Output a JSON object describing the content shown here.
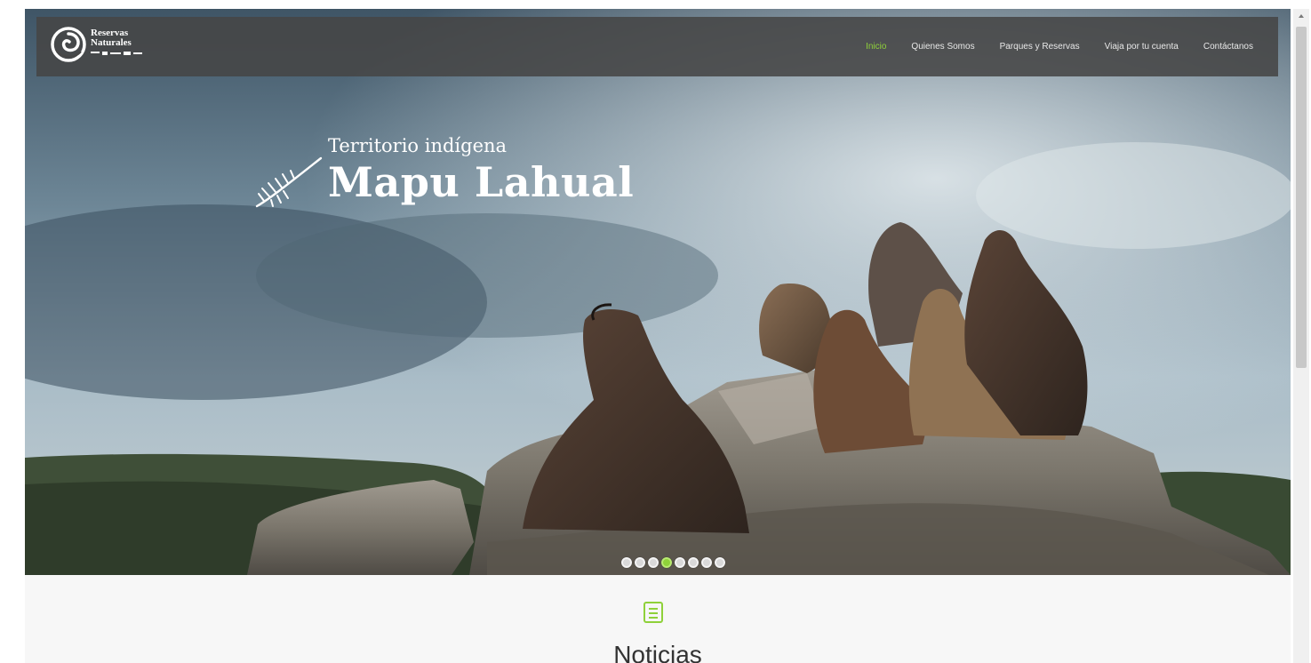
{
  "logo": {
    "line1": "Reservas",
    "line2": "Naturales",
    "icon": "swirl-logo-icon"
  },
  "nav": {
    "items": [
      {
        "label": "Inicio",
        "active": true
      },
      {
        "label": "Quienes Somos",
        "active": false
      },
      {
        "label": "Parques y Reservas",
        "active": false
      },
      {
        "label": "Viaja por tu cuenta",
        "active": false
      },
      {
        "label": "Contáctanos",
        "active": false
      }
    ]
  },
  "hero": {
    "subtitle": "Territorio indígena",
    "title": "Mapu Lahual",
    "decoration_icon": "feather-icon"
  },
  "slider": {
    "total_slides": 8,
    "active_index": 3
  },
  "news": {
    "icon": "newspaper-icon",
    "title": "Noticias"
  },
  "colors": {
    "accent": "#8fd13a",
    "nav_background": "#464646",
    "section_background": "#f7f7f7"
  }
}
